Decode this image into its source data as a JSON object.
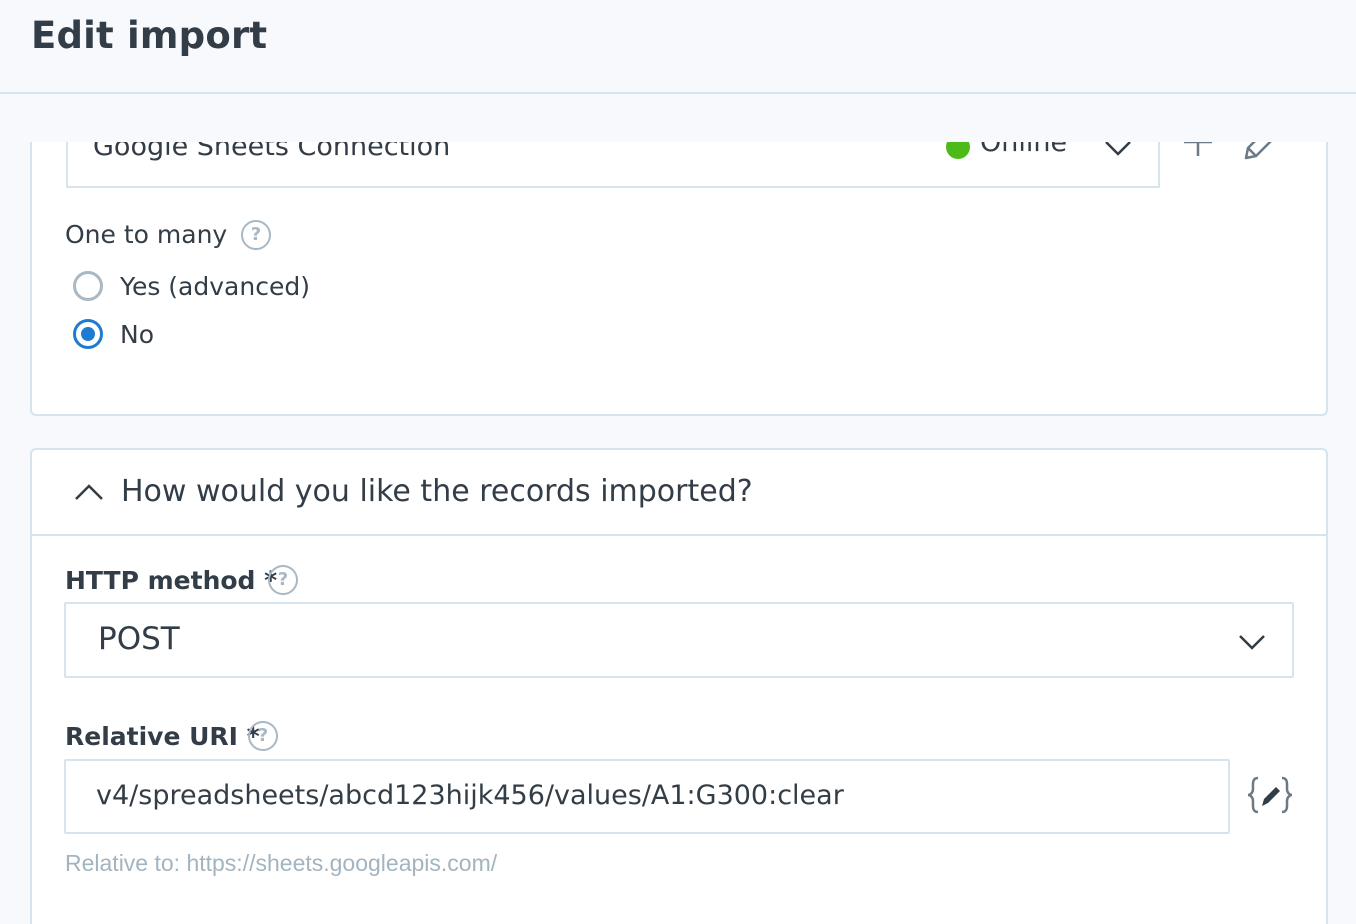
{
  "header": {
    "title": "Edit import"
  },
  "connection": {
    "selected": "Google Sheets Connection",
    "status": "Online",
    "status_color": "#4cbb17",
    "icons": [
      "chevron-down-icon",
      "plus-icon",
      "pencil-icon"
    ]
  },
  "one_to_many": {
    "label": "One to many",
    "options": [
      {
        "label": "Yes (advanced)",
        "checked": false
      },
      {
        "label": "No",
        "checked": true
      }
    ]
  },
  "records_section": {
    "title": "How would you like the records imported?",
    "expanded": true,
    "http_method": {
      "label": "HTTP method *",
      "value": "POST"
    },
    "relative_uri": {
      "label": "Relative URI *",
      "value": "v4/spreadsheets/abcd123hijk456/values/A1:G300:clear",
      "hint": "Relative to: https://sheets.googleapis.com/"
    }
  },
  "colors": {
    "accent": "#1f7bd1",
    "border": "#d6e4ed",
    "text": "#333d47",
    "muted": "#a3b4c1"
  }
}
